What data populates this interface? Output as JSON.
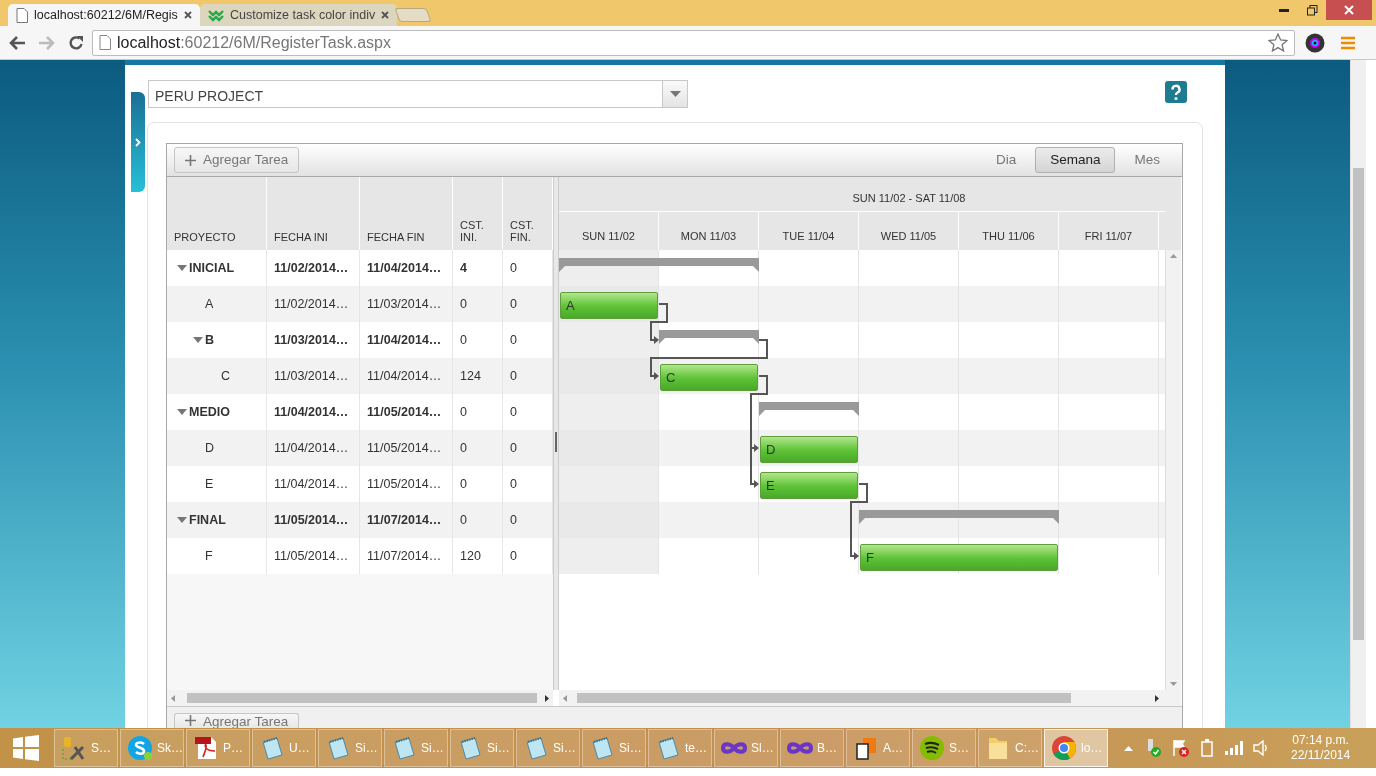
{
  "browser": {
    "tabs": [
      {
        "title": "localhost:60212/6M/Regis",
        "kind": "page",
        "selected": true
      },
      {
        "title": "Customize task color indiv",
        "kind": "kendo",
        "selected": false
      }
    ],
    "url": {
      "host": "localhost",
      "path": ":60212/6M/RegisterTask.aspx"
    }
  },
  "project_select": {
    "value": "PERU PROJECT"
  },
  "gantt": {
    "add_button": "Agregar Tarea",
    "views": [
      {
        "label": "Dia",
        "selected": false
      },
      {
        "label": "Semana",
        "selected": true
      },
      {
        "label": "Mes",
        "selected": false
      }
    ],
    "columns": [
      "PROYECTO",
      "FECHA INI",
      "FECHA FIN",
      "CST. INI.",
      "CST. FIN."
    ],
    "week_header": "SUN 11/02 - SAT 11/08",
    "days": [
      {
        "label": "SUN 11/02",
        "weekend": true
      },
      {
        "label": "MON 11/03",
        "weekend": false
      },
      {
        "label": "TUE 11/04",
        "weekend": false
      },
      {
        "label": "WED 11/05",
        "weekend": false
      },
      {
        "label": "THU 11/06",
        "weekend": false
      },
      {
        "label": "FRI 11/07",
        "weekend": false
      }
    ],
    "tasks": [
      {
        "name": "INICIAL",
        "start": "11/02/2014…",
        "end": "11/04/2014…",
        "cost_start": "4",
        "cost_end": "0",
        "expanded": true,
        "children": [
          {
            "name": "A",
            "bar_label": "A",
            "start": "11/02/2014…",
            "end": "11/03/2014…",
            "cost_start": "0",
            "cost_end": "0"
          },
          {
            "name": "B",
            "start": "11/03/2014…",
            "end": "11/04/2014…",
            "cost_start": "0",
            "cost_end": "0",
            "expanded": true,
            "children": [
              {
                "name": "C",
                "bar_label": "C",
                "start": "11/03/2014…",
                "end": "11/04/2014…",
                "cost_start": "124",
                "cost_end": "0"
              }
            ]
          }
        ]
      },
      {
        "name": "MEDIO",
        "start": "11/04/2014…",
        "end": "11/05/2014…",
        "cost_start": "0",
        "cost_end": "0",
        "expanded": true,
        "children": [
          {
            "name": "D",
            "bar_label": "D",
            "start": "11/04/2014…",
            "end": "11/05/2014…",
            "cost_start": "0",
            "cost_end": "0"
          },
          {
            "name": "E",
            "bar_label": "E",
            "start": "11/04/2014…",
            "end": "11/05/2014…",
            "cost_start": "0",
            "cost_end": "0"
          }
        ]
      },
      {
        "name": "FINAL",
        "start": "11/05/2014…",
        "end": "11/07/2014…",
        "cost_start": "0",
        "cost_end": "0",
        "expanded": true,
        "children": [
          {
            "name": "F",
            "bar_label": "F",
            "start": "11/05/2014…",
            "end": "11/07/2014…",
            "cost_start": "120",
            "cost_end": "0"
          }
        ]
      }
    ],
    "footer_button": "Agregar Tarea"
  },
  "taskbar": {
    "items": [
      {
        "label": "S…",
        "kind": "tools",
        "selected": false
      },
      {
        "label": "Sk…",
        "kind": "skype",
        "selected": false
      },
      {
        "label": "P…",
        "kind": "pdf",
        "selected": false
      },
      {
        "label": "U…",
        "kind": "notepad",
        "selected": false
      },
      {
        "label": "Si…",
        "kind": "notepad",
        "selected": false
      },
      {
        "label": "Si…",
        "kind": "notepad",
        "selected": false
      },
      {
        "label": "Si…",
        "kind": "notepad",
        "selected": false
      },
      {
        "label": "Si…",
        "kind": "notepad",
        "selected": false
      },
      {
        "label": "Si…",
        "kind": "notepad",
        "selected": false
      },
      {
        "label": "te…",
        "kind": "notepad",
        "selected": false
      },
      {
        "label": "Sl…",
        "kind": "infinity",
        "selected": false
      },
      {
        "label": "B…",
        "kind": "infinity",
        "selected": false
      },
      {
        "label": "A…",
        "kind": "files",
        "selected": false
      },
      {
        "label": "S…",
        "kind": "spotify",
        "selected": false
      },
      {
        "label": "C:…",
        "kind": "folder",
        "selected": false
      },
      {
        "label": "lo…",
        "kind": "chrome",
        "selected": true
      }
    ],
    "clock": {
      "time": "07:14 p.m.",
      "date": "22/11/2014"
    }
  }
}
